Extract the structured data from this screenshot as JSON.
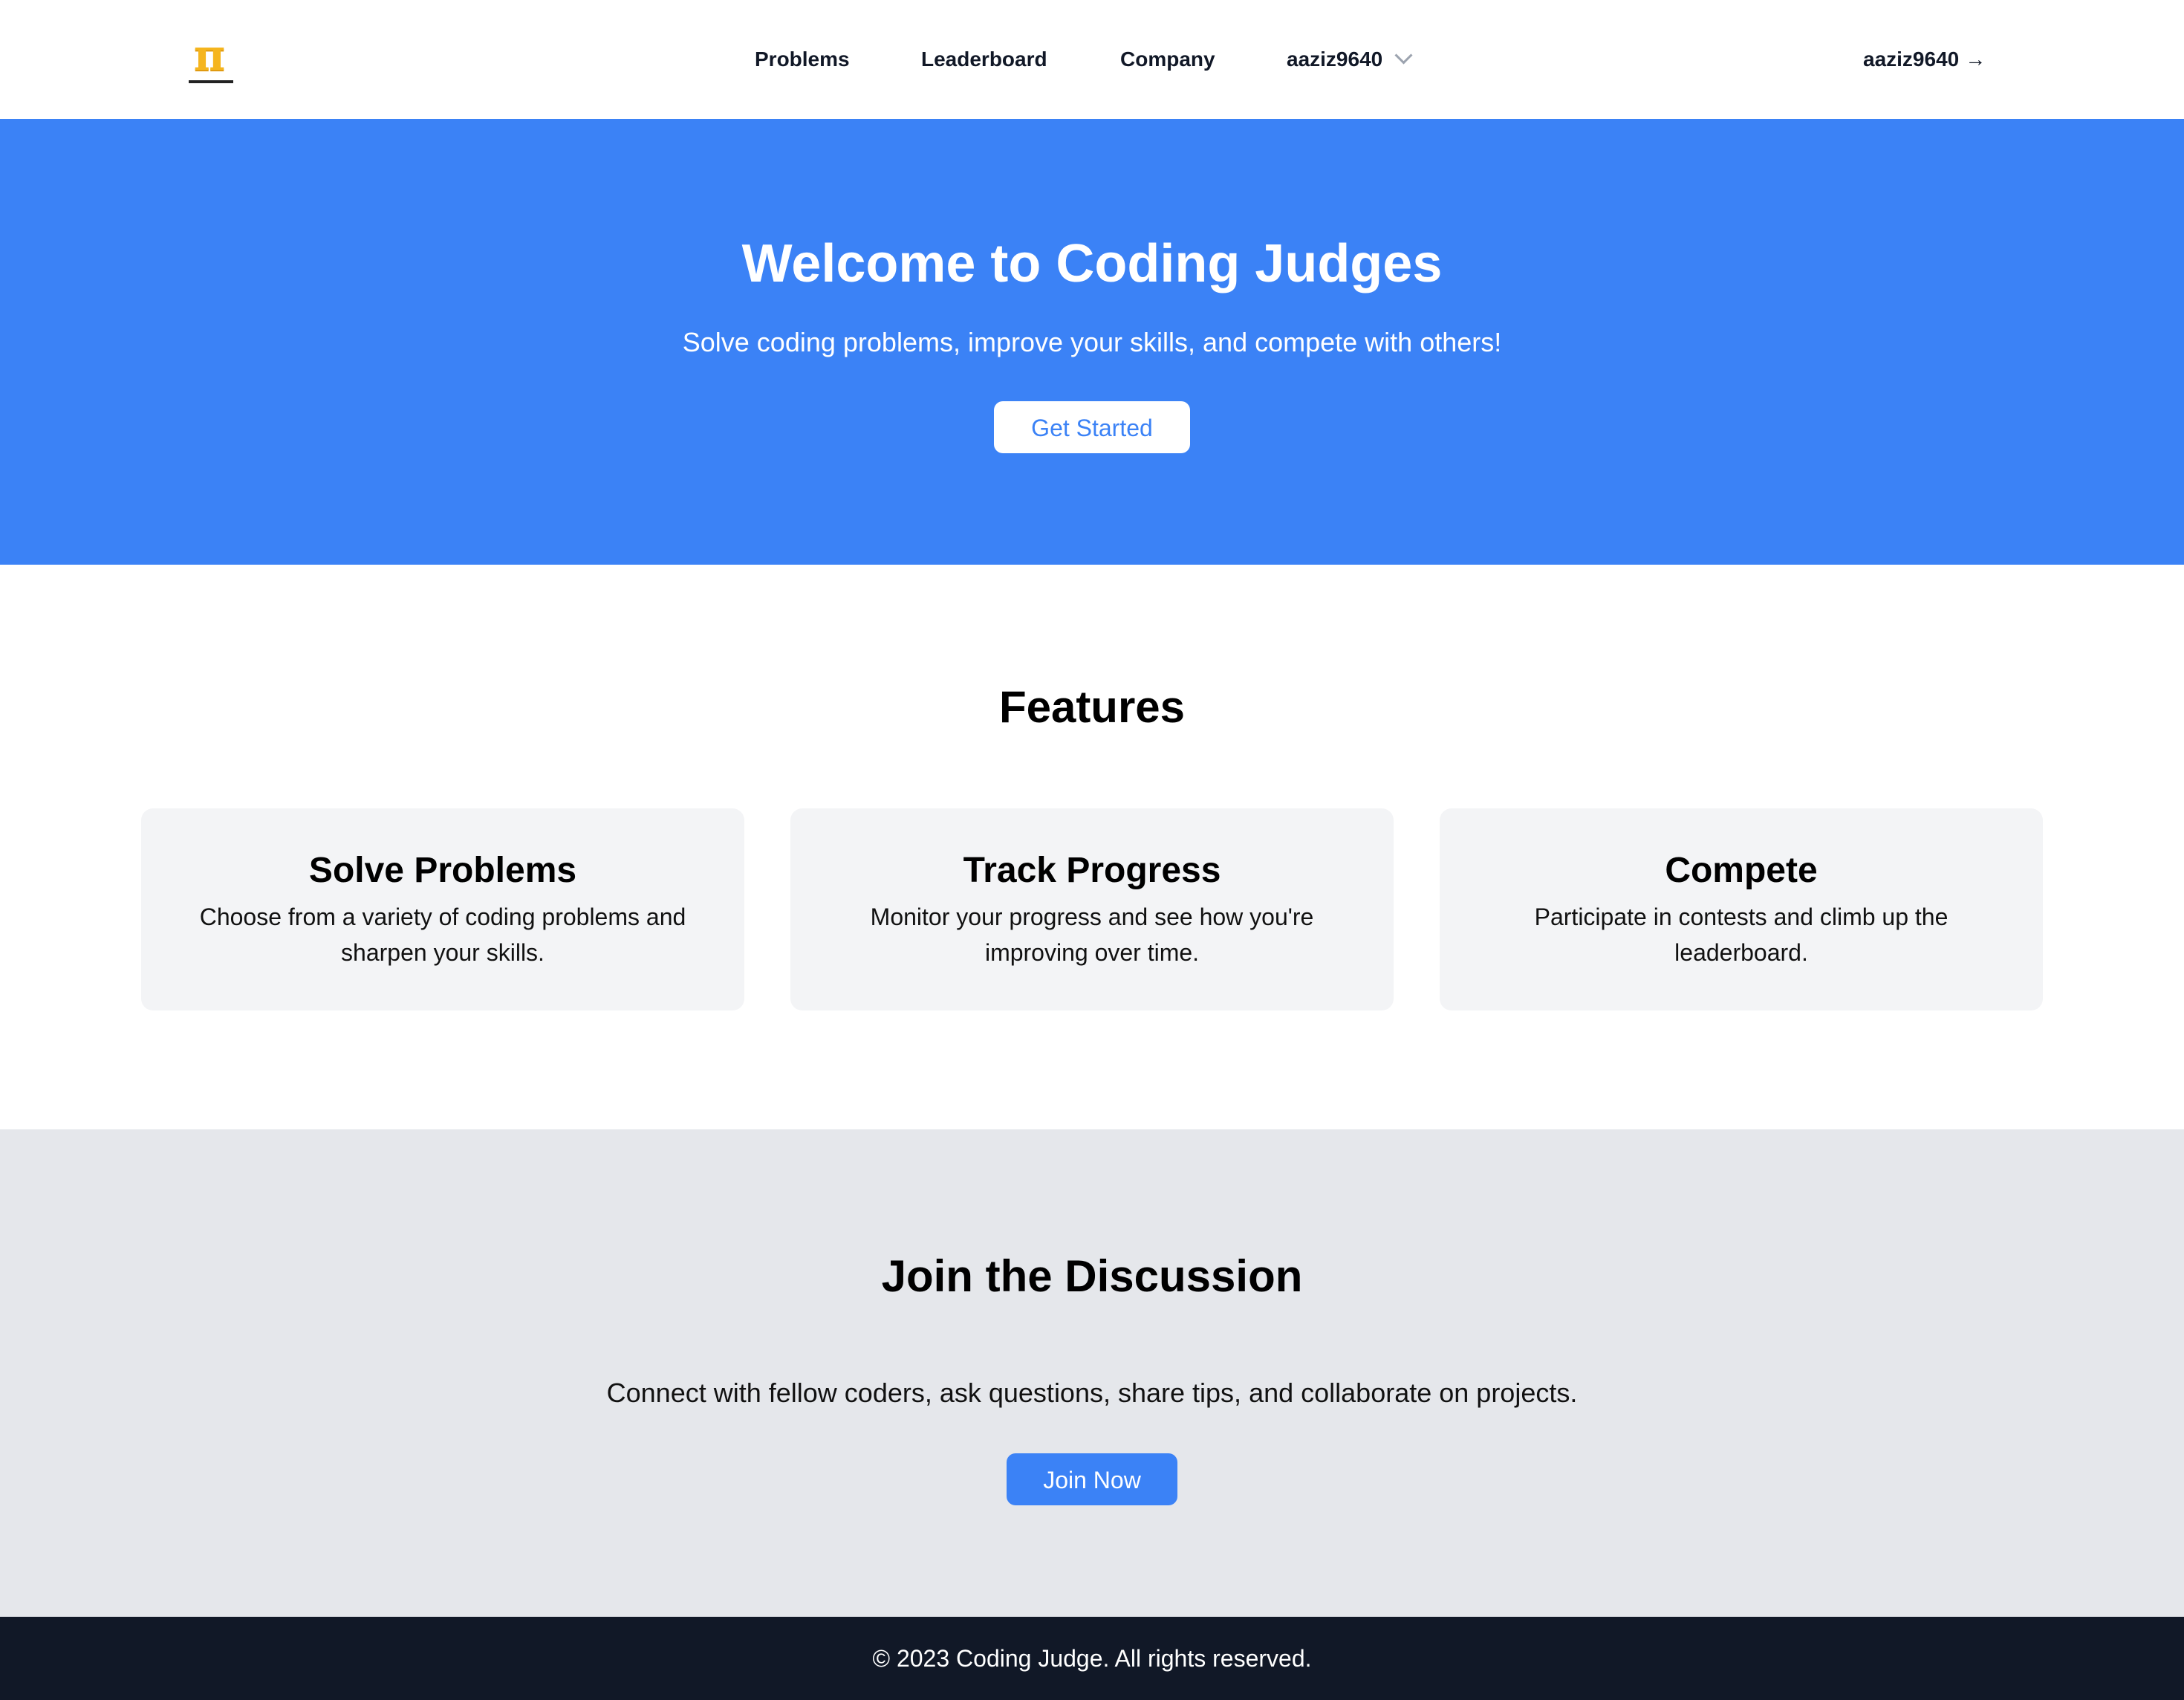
{
  "header": {
    "logo_icon": "pi-icon",
    "nav": {
      "problems": "Problems",
      "leaderboard": "Leaderboard",
      "company": "Company",
      "user_menu": "aaziz9640"
    },
    "login_link": "aaziz9640",
    "login_arrow": "→"
  },
  "hero": {
    "title": "Welcome to Coding Judges",
    "subtitle": "Solve coding problems, improve your skills, and compete with others!",
    "cta_label": "Get Started",
    "background_color": "#3b82f6"
  },
  "features": {
    "title": "Features",
    "cards": [
      {
        "title": "Solve Problems",
        "description": "Choose from a variety of coding problems and sharpen your skills."
      },
      {
        "title": "Track Progress",
        "description": "Monitor your progress and see how you're improving over time."
      },
      {
        "title": "Compete",
        "description": "Participate in contests and climb up the leaderboard."
      }
    ]
  },
  "discussion": {
    "title": "Join the Discussion",
    "description": "Connect with fellow coders, ask questions, share tips, and collaborate on projects.",
    "join_label": "Join Now"
  },
  "footer": {
    "copyright": "© 2023 Coding Judge. All rights reserved.",
    "background_color": "#111827"
  }
}
